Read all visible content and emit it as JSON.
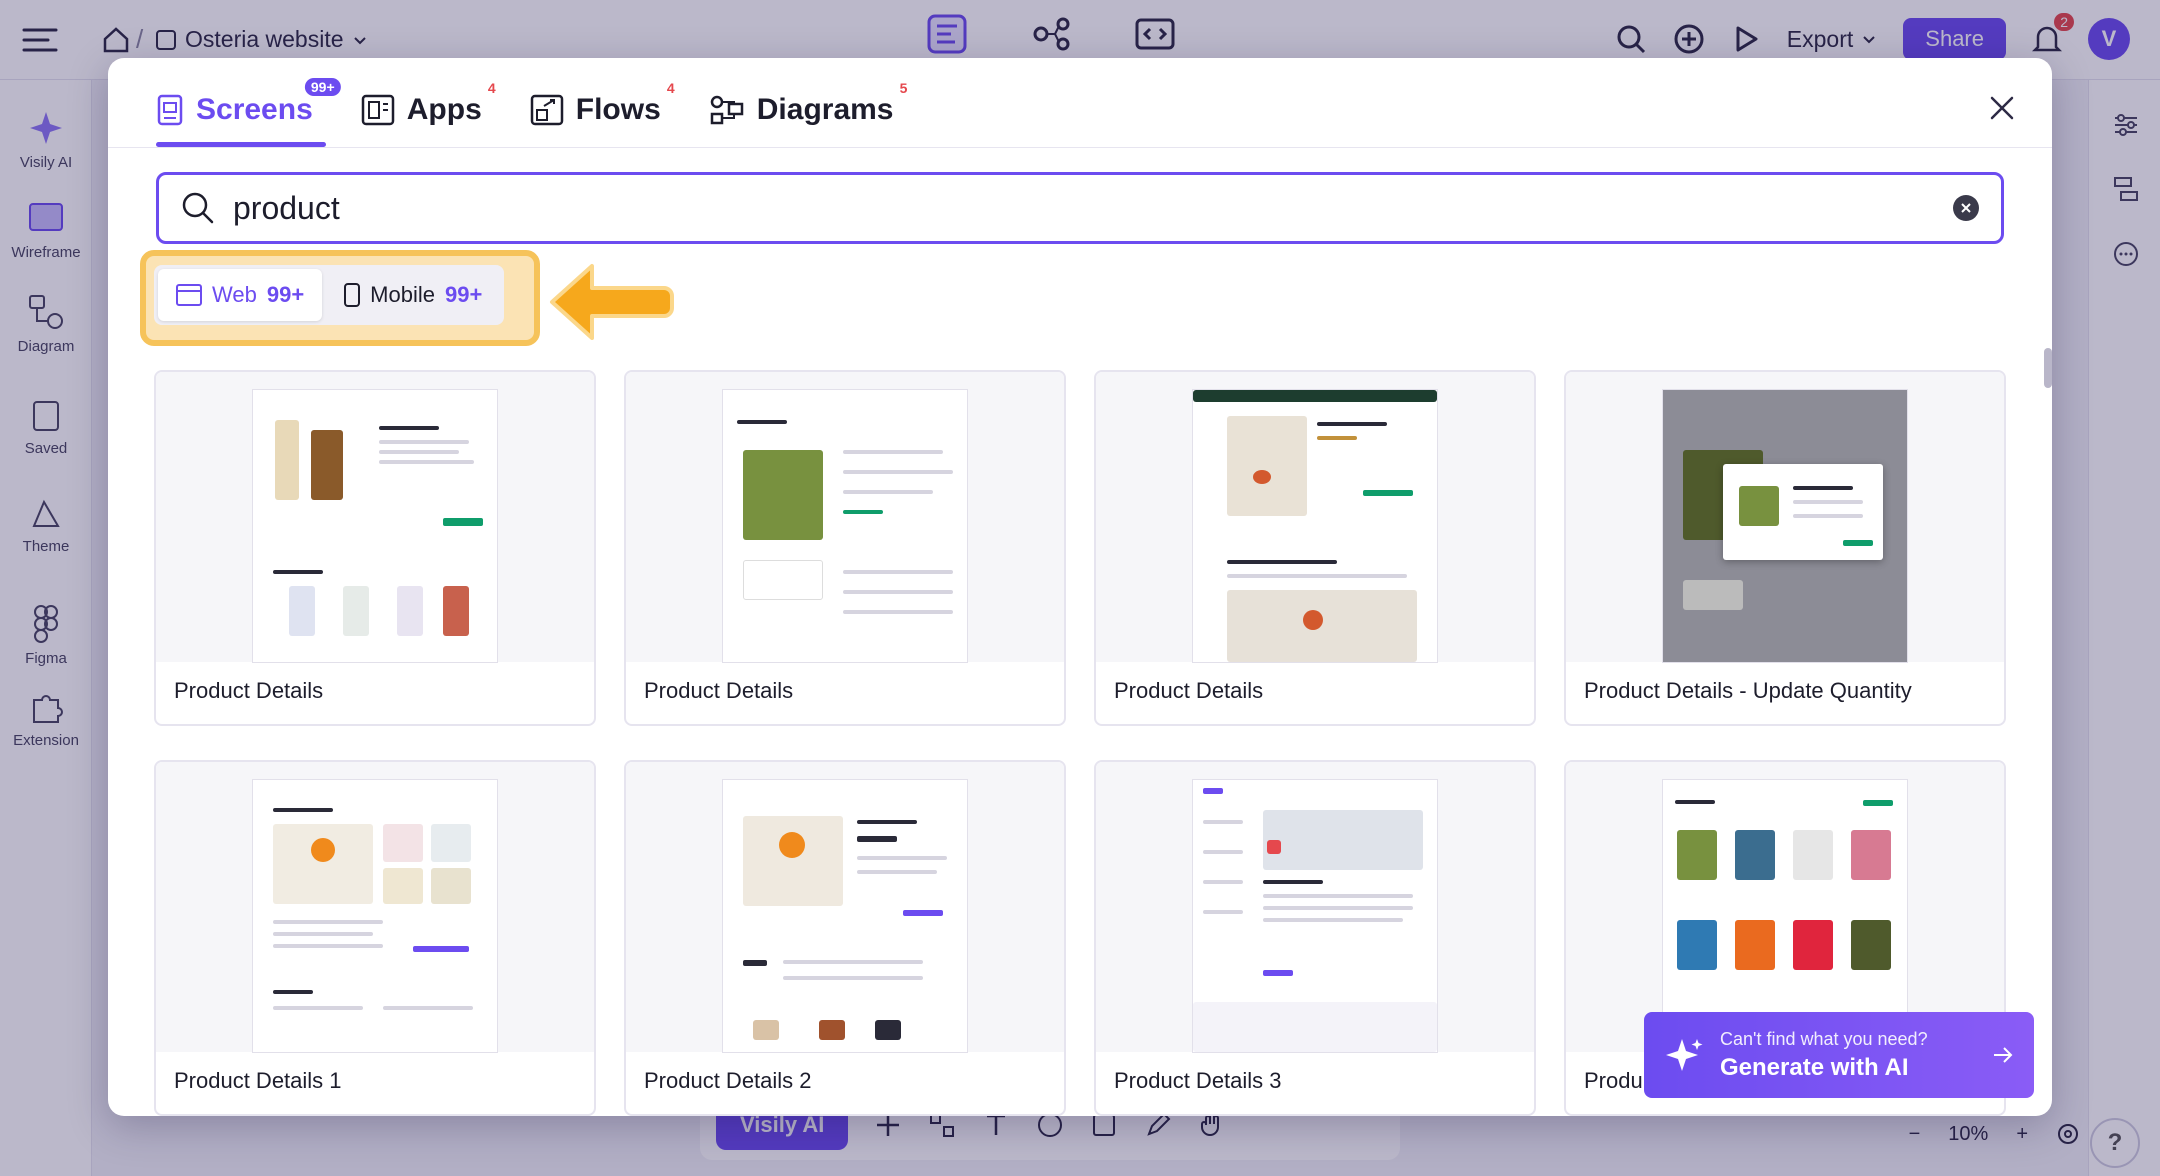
{
  "topbar": {
    "project_name": "Osteria website",
    "export_label": "Export",
    "share_label": "Share",
    "notif_count": "2",
    "avatar_letter": "V"
  },
  "leftbar": {
    "items": [
      {
        "label": "Visily AI"
      },
      {
        "label": "Wireframe"
      },
      {
        "label": "Diagram"
      },
      {
        "label": "Saved"
      },
      {
        "label": "Theme"
      },
      {
        "label": "Figma"
      },
      {
        "label": "Extension"
      }
    ]
  },
  "bottom": {
    "visily_label": "Visily AI",
    "zoom_label": "10%"
  },
  "modal": {
    "tabs": [
      {
        "label": "Screens",
        "badge": "99+"
      },
      {
        "label": "Apps",
        "badge": "4"
      },
      {
        "label": "Flows",
        "badge": "4"
      },
      {
        "label": "Diagrams",
        "badge": "5"
      }
    ],
    "search": {
      "value": "product"
    },
    "filters": [
      {
        "label": "Web",
        "count": "99+"
      },
      {
        "label": "Mobile",
        "count": "99+"
      }
    ],
    "cards": [
      {
        "title": "Product Details"
      },
      {
        "title": "Product Details"
      },
      {
        "title": "Product Details"
      },
      {
        "title": "Product Details - Update Quantity"
      },
      {
        "title": "Product Details 1"
      },
      {
        "title": "Product Details 2"
      },
      {
        "title": "Product Details 3"
      },
      {
        "title": "Produ"
      }
    ],
    "ai_banner": {
      "subtitle": "Can't find what you need?",
      "title": "Generate with AI"
    }
  },
  "colors": {
    "accent": "#6c4cf0",
    "highlight": "#f6c35a",
    "badge_red": "#e5484d"
  }
}
